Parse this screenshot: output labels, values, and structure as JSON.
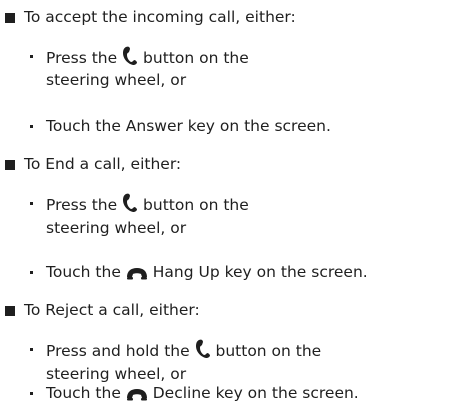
{
  "sections": [
    {
      "heading": "To accept the incoming call, either:",
      "items": [
        {
          "before": "Press the",
          "icon": "phone-handset-icon",
          "after": "button on the",
          "cont": "steering wheel, or"
        },
        {
          "text": "Touch the Answer key on the screen."
        }
      ]
    },
    {
      "heading": "To End a call, either:",
      "items": [
        {
          "before": "Press the",
          "icon": "phone-handset-icon",
          "after": "button on the",
          "cont": "steering wheel, or"
        },
        {
          "before": "Touch the",
          "icon": "hang-up-icon",
          "after": "Hang Up key on the screen."
        }
      ]
    },
    {
      "heading": "To Reject a call, either:",
      "items": [
        {
          "before": "Press and hold the",
          "icon": "phone-handset-icon",
          "after": "button on the",
          "cont": "steering wheel, or"
        },
        {
          "before": "Touch the",
          "icon": "hang-up-icon",
          "after": "Decline key on the screen."
        }
      ]
    }
  ]
}
